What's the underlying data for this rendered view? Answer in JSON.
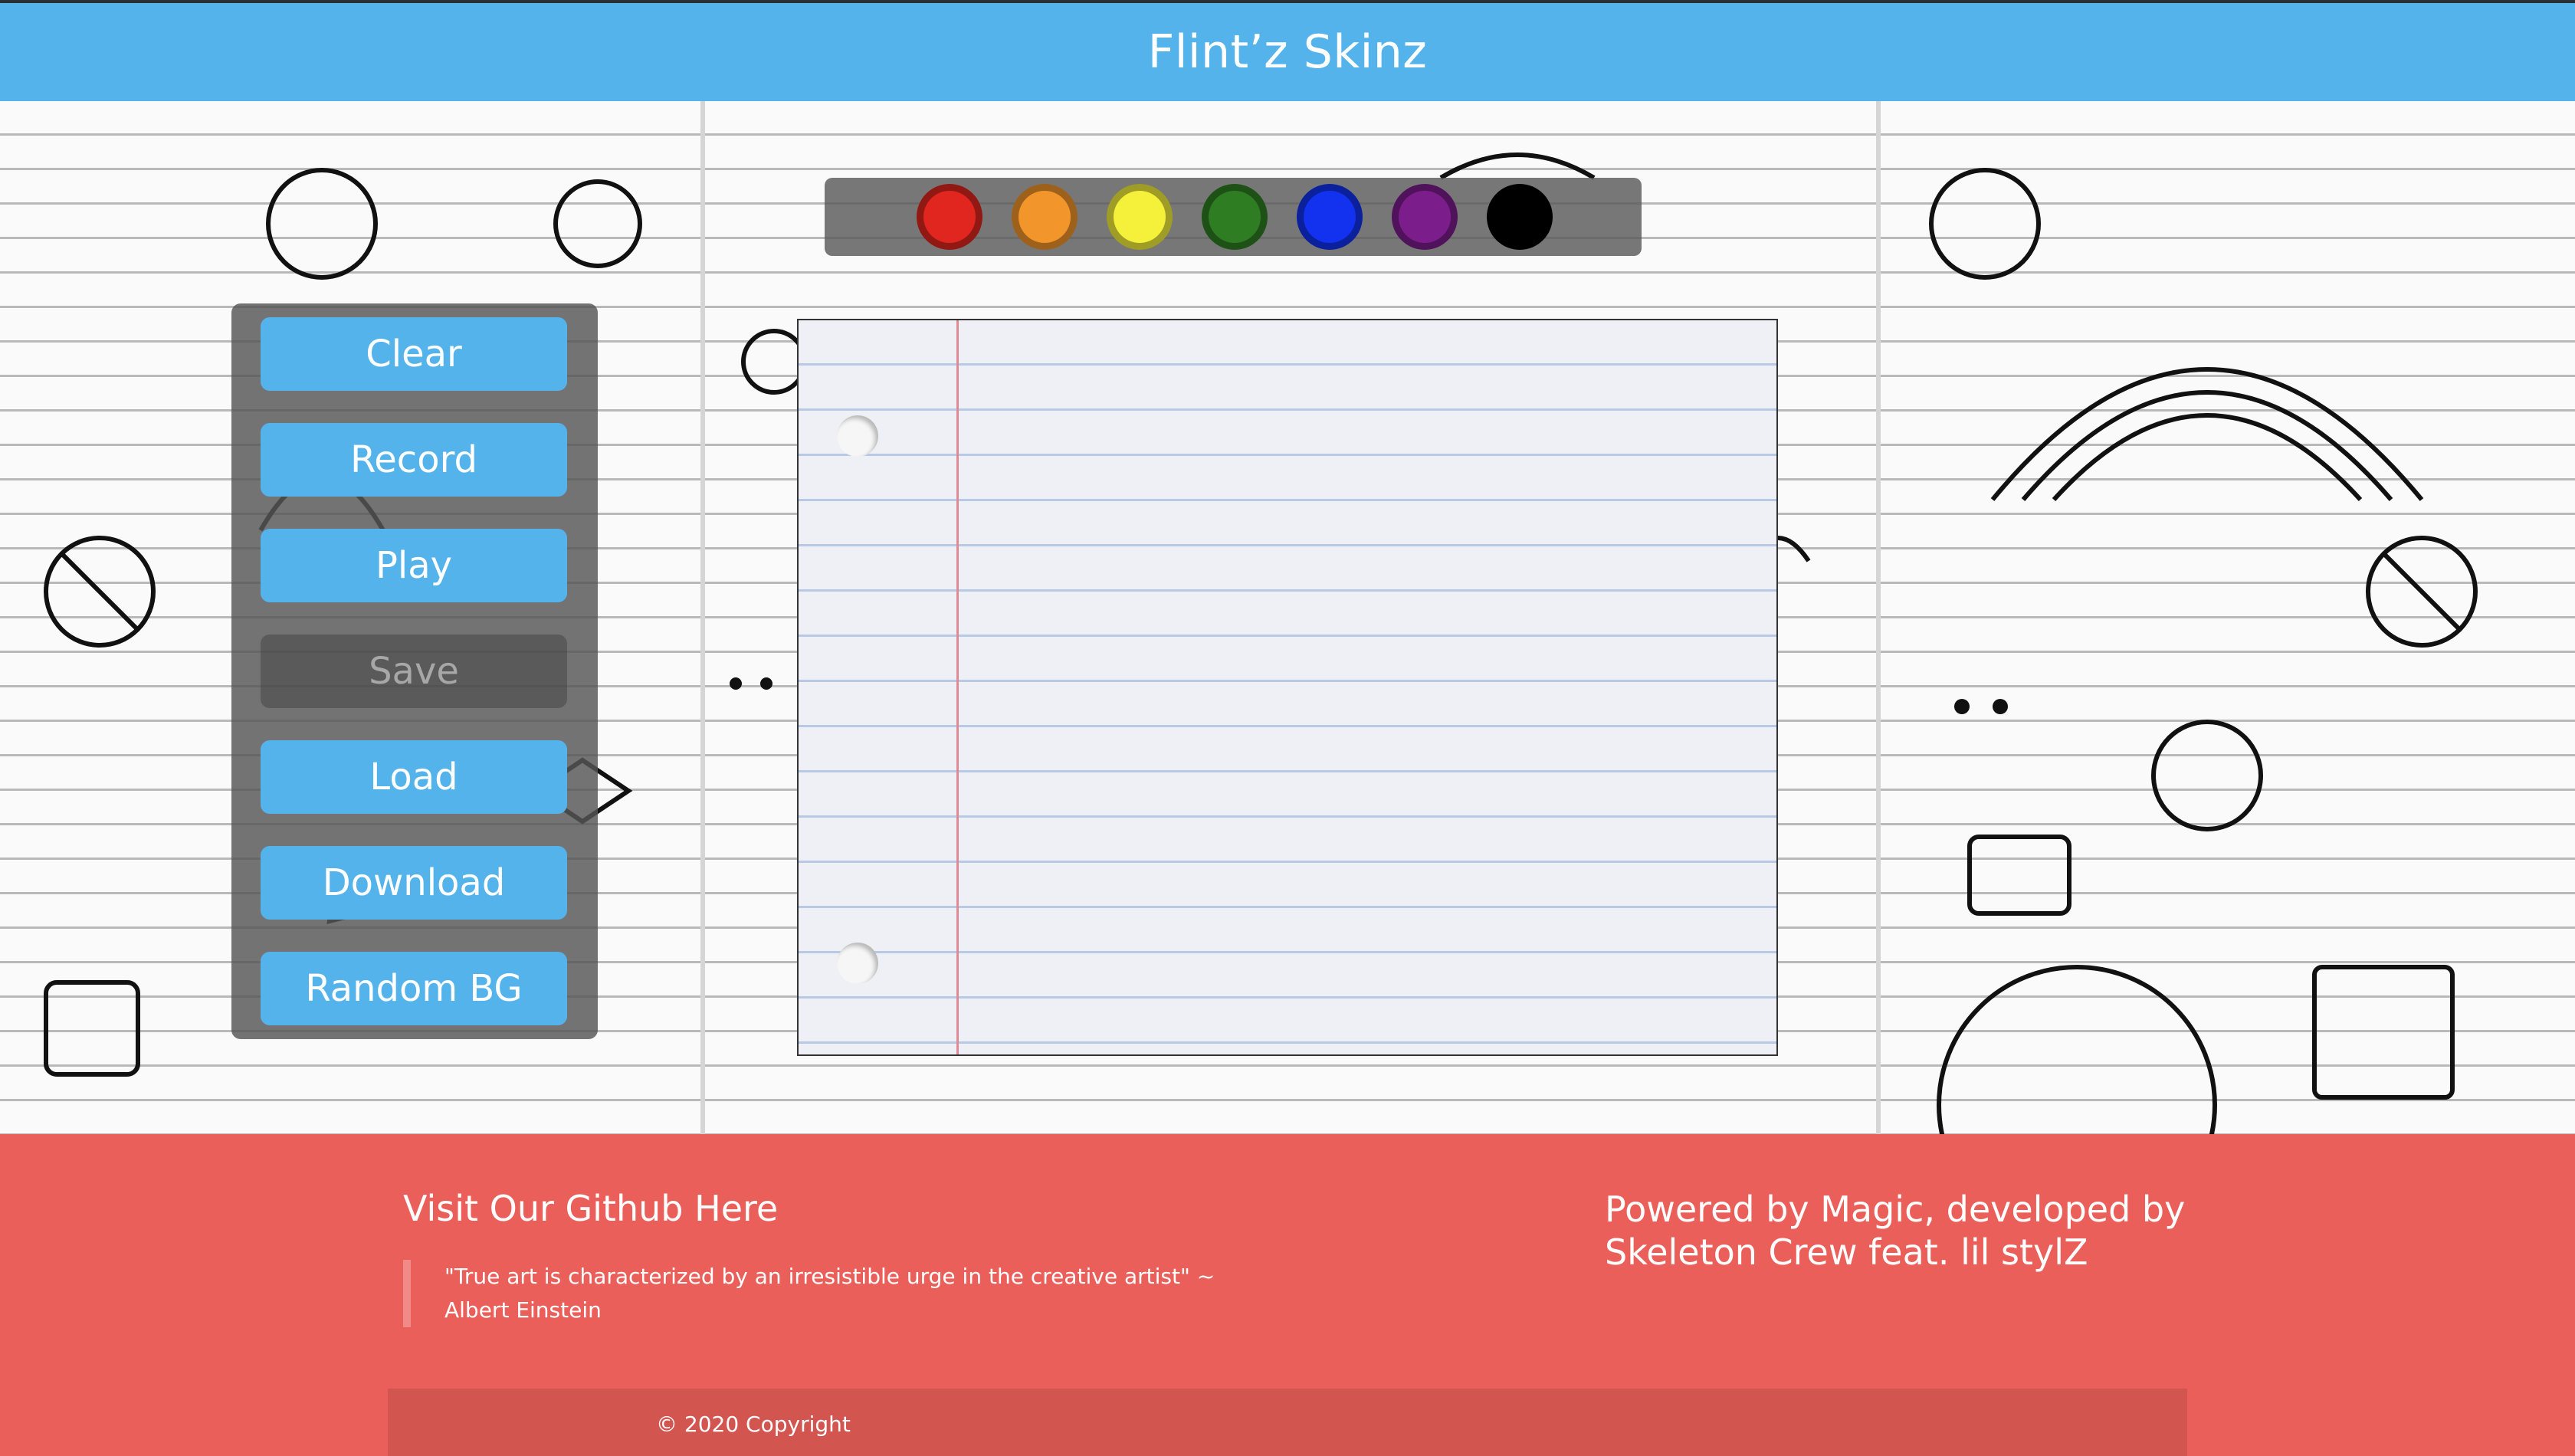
{
  "header": {
    "title": "Flint’z Skinz"
  },
  "palette": {
    "colors": [
      {
        "name": "red",
        "hex": "#e0261e"
      },
      {
        "name": "orange",
        "hex": "#f2952b"
      },
      {
        "name": "yellow",
        "hex": "#f5f13a"
      },
      {
        "name": "green",
        "hex": "#2e7d22"
      },
      {
        "name": "blue",
        "hex": "#1232f0"
      },
      {
        "name": "purple",
        "hex": "#7b1e8c"
      },
      {
        "name": "black",
        "hex": "#000000"
      }
    ]
  },
  "controls": {
    "clear": "Clear",
    "record": "Record",
    "play": "Play",
    "save": "Save",
    "load": "Load",
    "download": "Download",
    "random_bg": "Random BG"
  },
  "footer": {
    "github": "Visit Our Github Here",
    "quote": "\"True art is characterized by an irresistible urge in the creative artist\" ~ Albert Einstein",
    "powered": "Powered by Magic, developed by Skeleton Crew feat. lil stylZ",
    "copyright": "© 2020 Copyright"
  },
  "colors": {
    "accent_blue": "#55b3ec",
    "footer_red": "#eb5f5a"
  }
}
